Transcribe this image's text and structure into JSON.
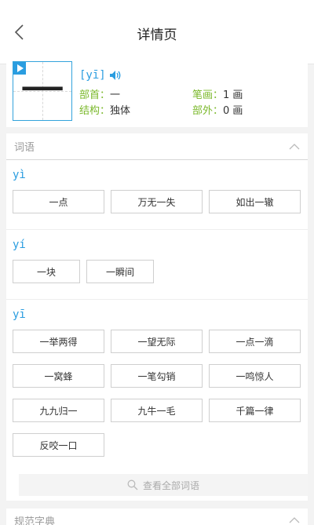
{
  "header": {
    "title": "详情页",
    "back_icon": "chevron-left-icon"
  },
  "character": {
    "glyph": "一",
    "pinyin": "[yī]",
    "radical_label": "部首：",
    "radical_value": "一",
    "strokes_label": "笔画：",
    "strokes_value": "1 画",
    "structure_label": "结构：",
    "structure_value": "独体",
    "extra_label": "部外：",
    "extra_value": "0 画"
  },
  "words_section": {
    "title": "词语",
    "groups": [
      {
        "pinyin": "yì",
        "words": [
          "一点",
          "万无一失",
          "如出一辙"
        ]
      },
      {
        "pinyin": "yí",
        "words": [
          "一块",
          "一瞬间"
        ]
      },
      {
        "pinyin": "yī",
        "words": [
          "一举两得",
          "一望无际",
          "一点一滴",
          "一窝蜂",
          "一笔勾销",
          "一鸣惊人",
          "九九归一",
          "九牛一毛",
          "千篇一律",
          "反咬一口"
        ]
      }
    ],
    "view_all": "查看全部词语"
  },
  "dictionary_section": {
    "title": "规范字典"
  },
  "colors": {
    "accent_blue": "#2a9de0",
    "label_green": "#7ab82a"
  }
}
